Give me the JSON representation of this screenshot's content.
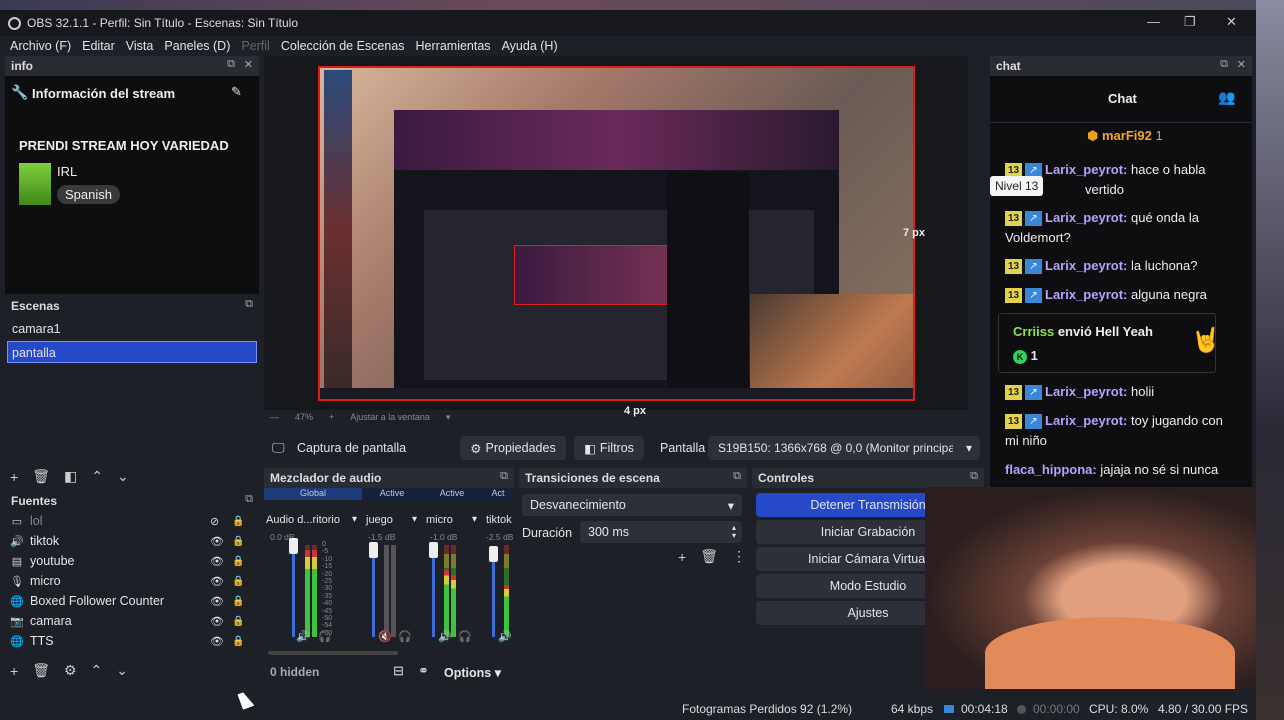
{
  "window": {
    "title": "OBS 32.1.1 - Perfil: Sin Título - Escenas: Sin Título"
  },
  "menu": [
    "Archivo (F)",
    "Editar",
    "Vista",
    "Paneles (D)",
    "Perfil",
    "Colección de Escenas",
    "Herramientas",
    "Ayuda (H)"
  ],
  "info_dock": {
    "header": "info",
    "title": "Información del stream",
    "stream_title": "PRENDI STREAM HOY VARIEDAD",
    "category": "IRL",
    "language": "Spanish"
  },
  "scenes": {
    "header": "Escenas",
    "items": [
      "camara1",
      "pantalla"
    ],
    "selected": "pantalla"
  },
  "sources": {
    "header": "Fuentes",
    "items": [
      "lol",
      "tiktok",
      "youtube",
      "micro",
      "Boxed Follower Counter",
      "camara",
      "TTS"
    ]
  },
  "preview": {
    "zoom": "47%",
    "fit_label": "Ajustar a la ventana",
    "right_px": "7 px",
    "bottom_px": "4 px"
  },
  "source_toolbar": {
    "source": "Captura de pantalla",
    "props": "Propiedades",
    "filters": "Filtros",
    "screen_label": "Pantalla",
    "screen_value": "S19B150: 1366x768 @ 0,0 (Monitor principa"
  },
  "mixer": {
    "header": "Mezclador de audio",
    "tabs": [
      "Global",
      "Active",
      "Active",
      "Act"
    ],
    "channels": [
      {
        "name": "Audio d...ritorio",
        "db": "0.0 dB"
      },
      {
        "name": "juego",
        "db": "-1.5 dB"
      },
      {
        "name": "micro",
        "db": "-1.0 dB"
      },
      {
        "name": "tiktok",
        "db": "-2.5 dB"
      }
    ],
    "scale": [
      "0",
      "-5",
      "-10",
      "-15",
      "-20",
      "-25",
      "-30",
      "-35",
      "-40",
      "-45",
      "-50",
      "-54",
      "-60"
    ],
    "hidden": "0 hidden",
    "options": "Options"
  },
  "transitions": {
    "header": "Transiciones de escena",
    "type": "Desvanecimiento",
    "duration_label": "Duración",
    "duration": "300 ms"
  },
  "controls": {
    "header": "Controles",
    "buttons": [
      "Detener Transmisión",
      "Iniciar Grabación",
      "Iniciar Cámara Virtual",
      "Modo Estudio",
      "Ajustes"
    ]
  },
  "chat_dock": {
    "header": "chat",
    "title": "Chat",
    "top_user": "marFi92",
    "top_count": "1",
    "tooltip": "Nivel 13",
    "messages": [
      {
        "user": "Larix_peyrot:",
        "text": "hace o habla",
        "cont": "vertido"
      },
      {
        "user": "Larix_peyrot:",
        "text": "qué onda la",
        "cont": "Voldemort?"
      },
      {
        "user": "Larix_peyrot:",
        "text": "la luchona?"
      },
      {
        "user": "Larix_peyrot:",
        "text": "alguna negra"
      }
    ],
    "gift": {
      "user": "Crriiss",
      "text": "envió Hell Yeah",
      "count": "1"
    },
    "messages2": [
      {
        "user": "Larix_peyrot:",
        "text": "holii"
      },
      {
        "user": "Larix_peyrot:",
        "text": "toy jugando con",
        "cont": "mi niño"
      },
      {
        "user": "flaca_hippona:",
        "text": "jajaja no sé si nunca"
      }
    ],
    "badge": "13"
  },
  "status": {
    "dropped": "Fotogramas Perdidos 92 (1.2%)",
    "bitrate": "64 kbps",
    "live_time": "00:04:18",
    "rec_time": "00:00:00",
    "cpu": "CPU: 8.0%",
    "fps": "4.80 / 30.00 FPS"
  },
  "colors": {
    "accent": "#2549c9",
    "red_border": "#e01b1b",
    "chat_name": "#b6a2ff",
    "badge": "#e3d34a"
  }
}
